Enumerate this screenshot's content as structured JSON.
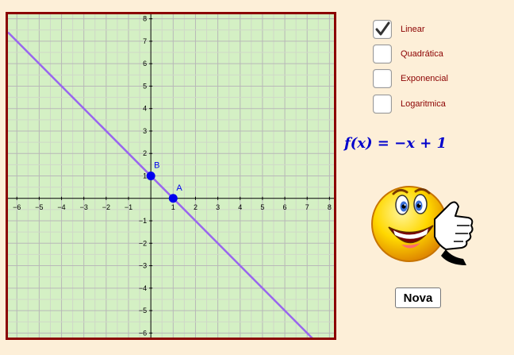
{
  "graph": {
    "x_ticks": [
      "−6",
      "−5",
      "−4",
      "−3",
      "−2",
      "−1",
      "1",
      "2",
      "3",
      "4",
      "5",
      "6",
      "7",
      "8"
    ],
    "y_ticks": [
      "8",
      "7",
      "6",
      "5",
      "4",
      "3",
      "2",
      "1",
      "−1",
      "−2",
      "−3",
      "−4",
      "−5",
      "−6"
    ],
    "x_tick_values": [
      -6,
      -5,
      -4,
      -3,
      -2,
      -1,
      1,
      2,
      3,
      4,
      5,
      6,
      7,
      8
    ],
    "y_tick_values": [
      8,
      7,
      6,
      5,
      4,
      3,
      2,
      1,
      -1,
      -2,
      -3,
      -4,
      -5,
      -6
    ],
    "x_range": [
      -6.4,
      8.2
    ],
    "y_range": [
      -6.2,
      8.2
    ],
    "line": {
      "slope": -1,
      "intercept": 1,
      "color": "#9966ee"
    },
    "points": [
      {
        "name": "B",
        "x": 0,
        "y": 1
      },
      {
        "name": "A",
        "x": 1,
        "y": 0
      }
    ],
    "point_color": "#0000ee",
    "background": "#d4f0c4",
    "grid_color": "#bdbdbd",
    "border_color": "#8b0000"
  },
  "options": [
    {
      "label": "Linear",
      "checked": true
    },
    {
      "label": "Quadrática",
      "checked": false
    },
    {
      "label": "Exponencial",
      "checked": false
    },
    {
      "label": "Logaritmica",
      "checked": false
    }
  ],
  "formula": "f(x) = −x + 1",
  "nova_label": "Nova",
  "mascot_icon": "thumbs-up-smiley-icon"
}
